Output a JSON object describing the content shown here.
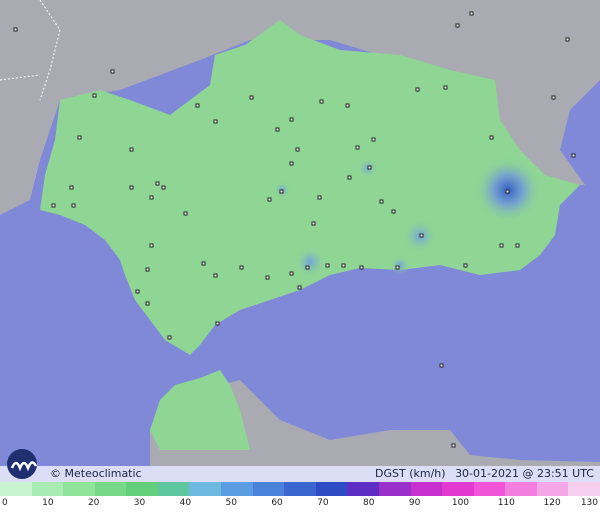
{
  "brand": {
    "name": "Meteoclimatic",
    "credit": "© Meteoclimatic",
    "logo_letter": "m"
  },
  "stamp": {
    "variable": "DGST (km/h)",
    "datetime": "30-01-2021 @ 23:51 UTC"
  },
  "colors": {
    "sea": "#7f89d8",
    "land_gray": "#a9aab2",
    "land_green": "#8fd694",
    "land_darkgreen": "#6cc47a",
    "gust_blue": "#2f56c9"
  },
  "scale": {
    "labels": [
      "0",
      "10",
      "20",
      "30",
      "40",
      "50",
      "60",
      "70",
      "80",
      "90",
      "100",
      "110",
      "120",
      "130"
    ],
    "colors": [
      "#c8f5cf",
      "#a8ecb4",
      "#8fe39b",
      "#77d987",
      "#63cf7a",
      "#5fc7a0",
      "#6fb8e0",
      "#5a9de0",
      "#4a82da",
      "#3a66d0",
      "#2d4bc2",
      "#5e2ec4",
      "#9a2fc9",
      "#c82fcf",
      "#e23ad0",
      "#f055d8",
      "#f27ee0",
      "#f4a6e6",
      "#f7cfee"
    ]
  }
}
